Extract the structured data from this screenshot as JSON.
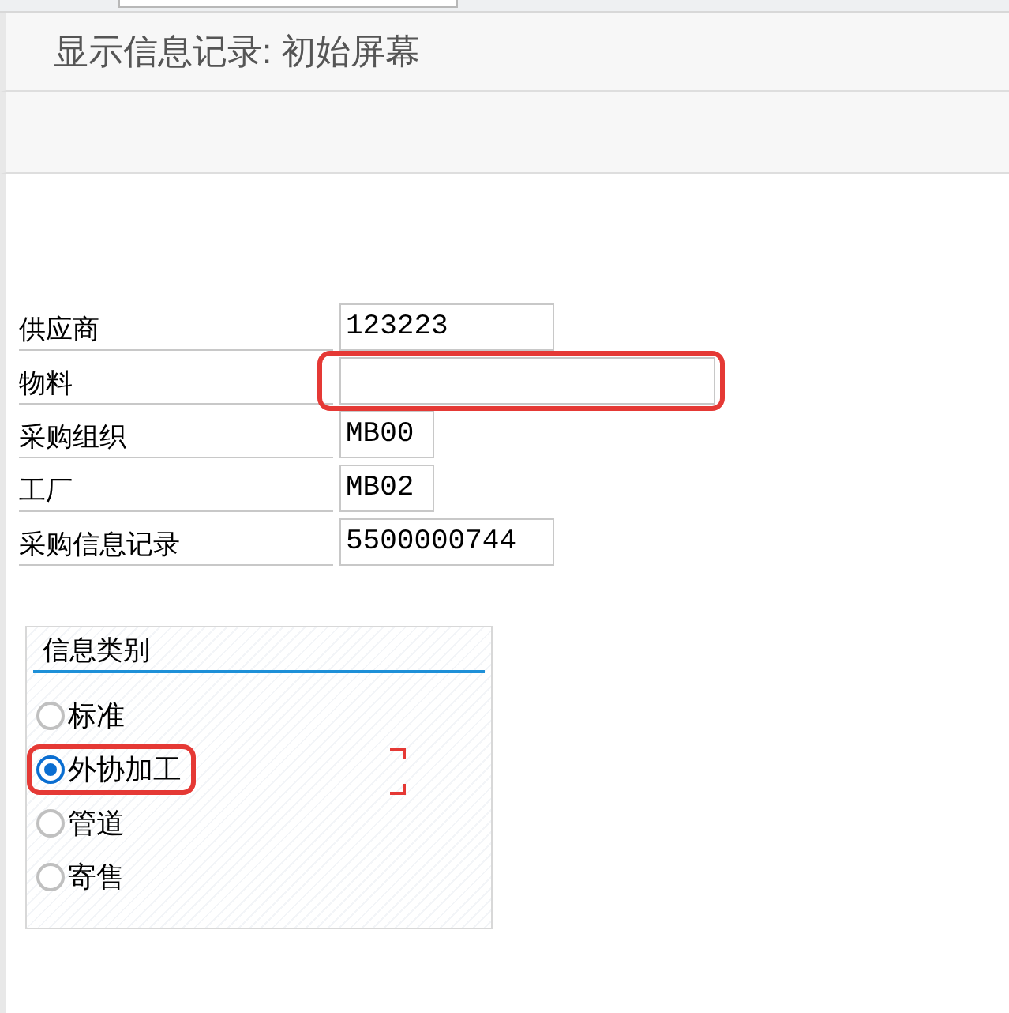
{
  "window": {
    "title": "显示信息记录: 初始屏幕"
  },
  "fields": [
    {
      "label": "供应商",
      "value": "123223",
      "kind": "medium",
      "highlighted": false
    },
    {
      "label": "物料",
      "kind": "long",
      "highlighted": true
    },
    {
      "label": "采购组织",
      "value": "MB00",
      "kind": "short",
      "highlighted": false
    },
    {
      "label": "工厂",
      "value": "MB02",
      "kind": "short",
      "highlighted": false
    },
    {
      "label": "采购信息记录",
      "value": "5500000744",
      "kind": "medium",
      "highlighted": false
    }
  ],
  "info_category": {
    "title": "信息类别",
    "options": [
      {
        "label": "标准",
        "selected": false
      },
      {
        "label": "外协加工",
        "selected": true
      },
      {
        "label": "管道",
        "selected": false
      },
      {
        "label": "寄售",
        "selected": false
      }
    ]
  }
}
